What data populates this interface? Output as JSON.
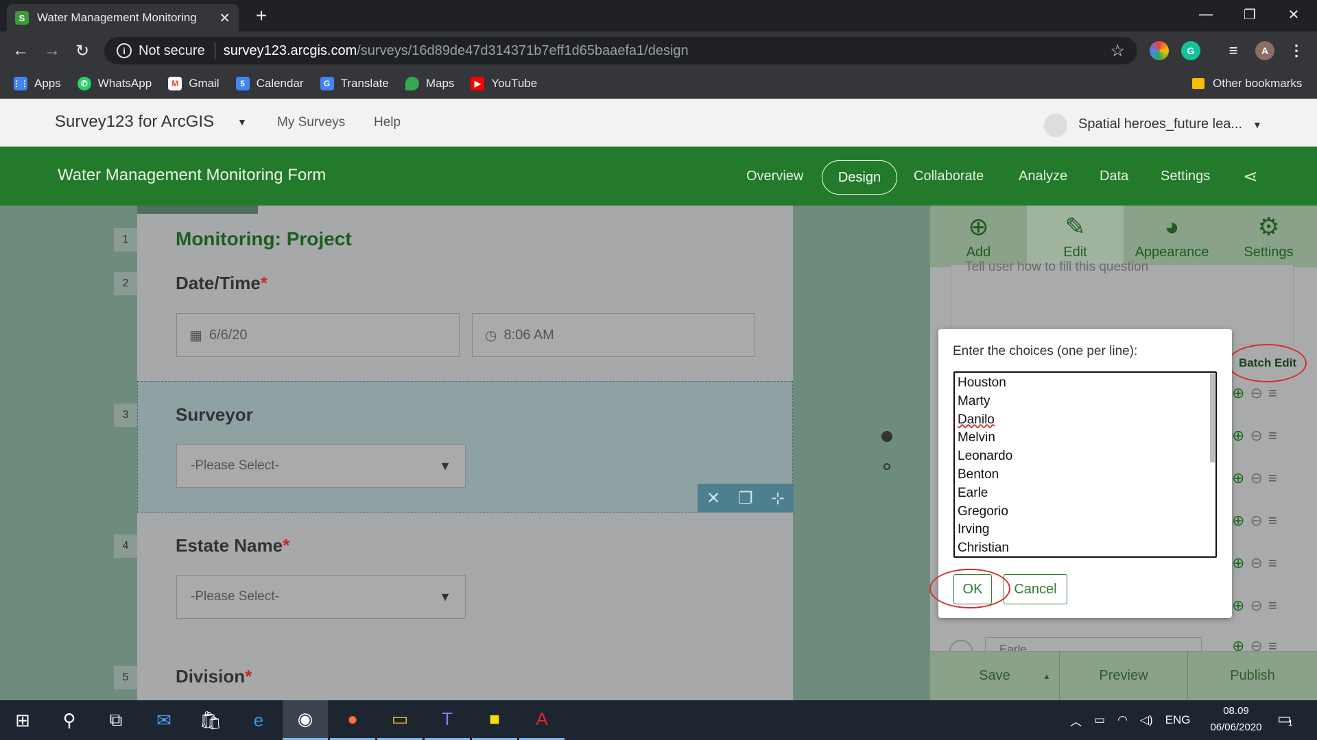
{
  "browser": {
    "tab_title": "Water Management Monitoring",
    "tab_favicon": "S",
    "omnibox": {
      "security": "Not secure",
      "host": "survey123.arcgis.com",
      "path": "/surveys/16d89de47d314371b7eff1d65baaefa1/design"
    },
    "profile_initial": "A",
    "bookmarks": [
      "Apps",
      "WhatsApp",
      "Gmail",
      "Calendar",
      "Translate",
      "Maps",
      "YouTube"
    ],
    "other_bookmarks": "Other bookmarks"
  },
  "app": {
    "name": "Survey123 for ArcGIS",
    "nav": {
      "my_surveys": "My Surveys",
      "help": "Help"
    },
    "user": "Spatial heroes_future lea..."
  },
  "survey": {
    "title": "Water Management Monitoring Form",
    "tabs": [
      "Overview",
      "Design",
      "Collaborate",
      "Analyze",
      "Data",
      "Settings"
    ],
    "active_tab": "Design"
  },
  "form": {
    "questions": [
      {
        "num": "1",
        "label": "Monitoring: Project"
      },
      {
        "num": "2",
        "label": "Date/Time",
        "required": "*",
        "date": "6/6/20",
        "time": "8:06 AM"
      },
      {
        "num": "3",
        "label": "Surveyor",
        "placeholder": "-Please Select-"
      },
      {
        "num": "4",
        "label": "Estate Name",
        "required": "*",
        "placeholder": "-Please Select-"
      },
      {
        "num": "5",
        "label": "Division",
        "required": "*"
      }
    ]
  },
  "panel": {
    "tabs": [
      "Add",
      "Edit",
      "Appearance",
      "Settings"
    ],
    "hint_placeholder": "Tell user how to fill this question",
    "batch_edit": "Batch Edit",
    "bottom": {
      "save": "Save",
      "preview": "Preview",
      "publish": "Publish"
    },
    "partial_choice": "Earle"
  },
  "modal": {
    "label": "Enter the choices (one per line):",
    "choices": [
      "Houston",
      "Marty",
      "Danilo",
      "Melvin",
      "Leonardo",
      "Benton",
      "Earle",
      "Gregorio",
      "Irving",
      "Christian"
    ],
    "ok": "OK",
    "cancel": "Cancel"
  },
  "taskbar": {
    "lang": "ENG",
    "time": "08.09",
    "date": "06/06/2020",
    "notifications": "1"
  },
  "colors": {
    "brand_green": "#237a2a",
    "annotation_red": "#d32f2f"
  }
}
